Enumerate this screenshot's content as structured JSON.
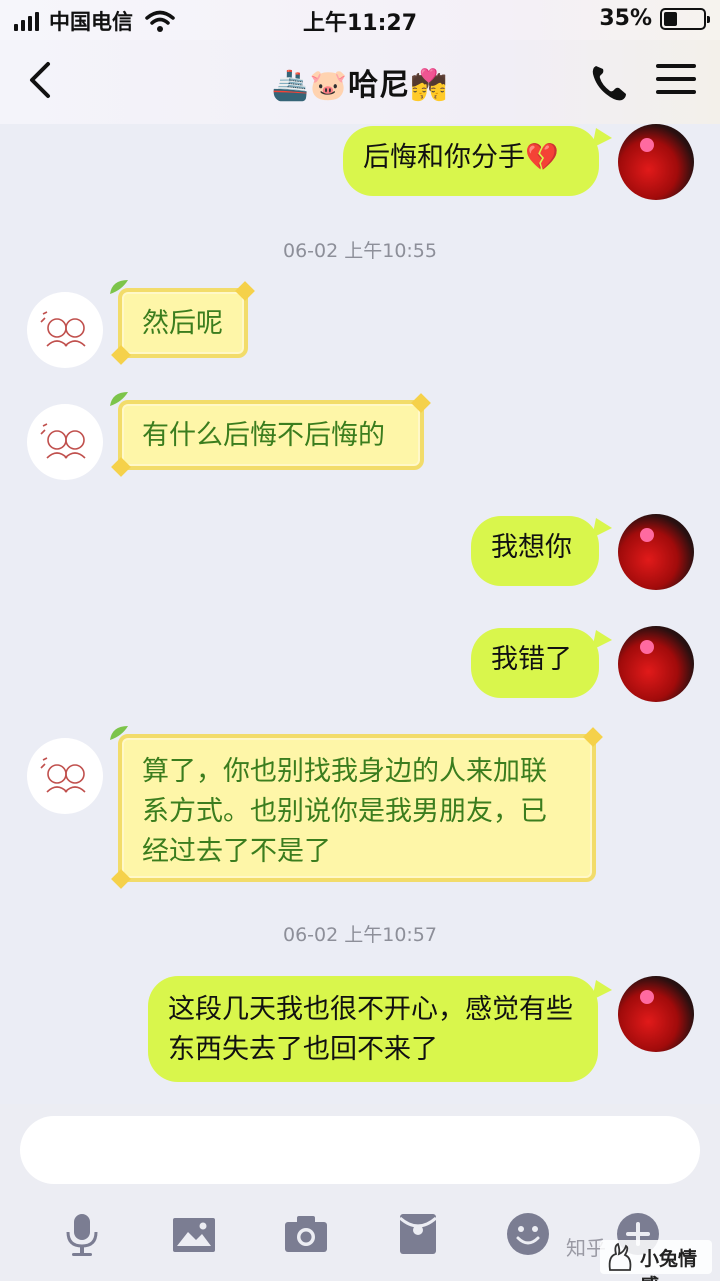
{
  "status_bar": {
    "carrier": "中国电信",
    "time": "上午11:27",
    "battery_percent": "35%",
    "battery_level": 0.35
  },
  "header": {
    "title": "🚢🐷哈尼💏"
  },
  "messages": [
    {
      "text": "后悔和你分手💔"
    },
    {
      "timestamp": "06-02 上午10:55"
    },
    {
      "text": "然后呢"
    },
    {
      "text": "有什么后悔不后悔的"
    },
    {
      "text": "我想你"
    },
    {
      "text": "我错了"
    },
    {
      "text": "算了，你也别找我身边的人来加联系方式。也别说你是我男朋友，已经过去了不是了"
    },
    {
      "timestamp": "06-02 上午10:57"
    },
    {
      "text": "这段几天我也很不开心，感觉有些东西失去了也回不来了"
    }
  ],
  "input": {
    "placeholder": ""
  },
  "toolbar": {
    "icons": [
      "microphone-icon",
      "image-icon",
      "camera-icon",
      "red-envelope-icon",
      "emoji-icon",
      "plus-icon"
    ]
  },
  "watermark": {
    "zhihu": "知乎",
    "brand": "小兔情感"
  },
  "colors": {
    "outgoing_bubble": "#d9f64c",
    "incoming_bubble": "#fef6a8",
    "incoming_text": "#3b7d1e",
    "background": "#ebedf5"
  }
}
